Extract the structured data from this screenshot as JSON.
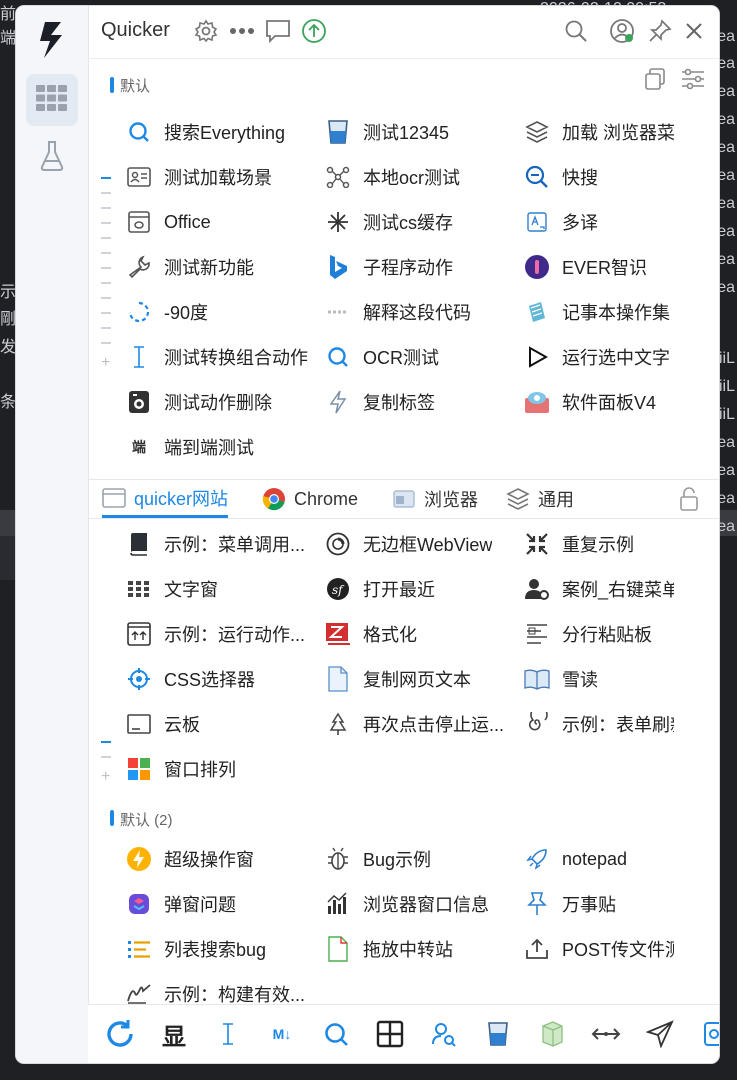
{
  "background": {
    "right_fragments": [
      "ea",
      "ea",
      "ea",
      "ea",
      "ea",
      "ea",
      "ea",
      "ea",
      "ea",
      "ea",
      "iiL",
      "iiL",
      "iiL",
      "ea",
      "ea",
      "ea",
      "ea"
    ],
    "left_fragments": [
      "示",
      "剛",
      "发",
      "条"
    ],
    "top_fragment": "前端",
    "top_clock": "2026-02-10 09:53"
  },
  "header": {
    "title": "Quicker",
    "icons": [
      "gear-icon",
      "more-icon",
      "chat-icon",
      "upgrade-icon",
      "search-icon",
      "user-icon",
      "pin-icon",
      "close-icon"
    ]
  },
  "group1": {
    "label": "默认",
    "items": [
      {
        "label": "搜索Everything",
        "icon": "search-everything-icon"
      },
      {
        "label": "测试12345",
        "icon": "cup-icon"
      },
      {
        "label": "加载 浏览器菜...",
        "icon": "layers-icon"
      },
      {
        "label": "测试加载场景",
        "icon": "id-card-icon"
      },
      {
        "label": "本地ocr测试",
        "icon": "nodes-icon"
      },
      {
        "label": "快搜",
        "icon": "quick-search-icon"
      },
      {
        "label": "Office",
        "icon": "office-icon"
      },
      {
        "label": "测试cs缓存",
        "icon": "asterisk-icon"
      },
      {
        "label": "多译",
        "icon": "translate-icon"
      },
      {
        "label": "测试新功能",
        "icon": "wrench-icon"
      },
      {
        "label": "子程序动作",
        "icon": "bing-icon"
      },
      {
        "label": "EVER智识",
        "icon": "ever-icon"
      },
      {
        "label": "-90度",
        "icon": "rotate-icon"
      },
      {
        "label": "解释这段代码",
        "icon": "code-icon"
      },
      {
        "label": "记事本操作集",
        "icon": "notepad-icon"
      },
      {
        "label": "测试转换组合动作",
        "icon": "text-cursor-icon"
      },
      {
        "label": "OCR测试",
        "icon": "ocr-search-icon"
      },
      {
        "label": "运行选中文字",
        "icon": "play-icon"
      },
      {
        "label": "测试动作删除",
        "icon": "camera-icon"
      },
      {
        "label": "复制标签",
        "icon": "bolt-icon"
      },
      {
        "label": "软件面板V4",
        "icon": "panel-icon"
      },
      {
        "label": "端到端测试",
        "icon": "duan-icon",
        "glyph": "端"
      }
    ]
  },
  "tabs": [
    {
      "label": "quicker网站",
      "icon": "browser-icon",
      "active": true
    },
    {
      "label": "Chrome",
      "icon": "chrome-icon",
      "active": false
    },
    {
      "label": "浏览器",
      "icon": "window-icon",
      "active": false
    },
    {
      "label": "通用",
      "icon": "layers-icon",
      "active": false
    }
  ],
  "group2": {
    "items": [
      {
        "label": "示例：菜单调用...",
        "icon": "book-icon"
      },
      {
        "label": "无边框WebView",
        "icon": "webview-icon"
      },
      {
        "label": "重复示例",
        "icon": "shrink-icon"
      },
      {
        "label": "文字窗",
        "icon": "grid-dots-icon"
      },
      {
        "label": "打开最近",
        "icon": "symfony-icon"
      },
      {
        "label": "案例_右键菜单...",
        "icon": "user-gear-icon"
      },
      {
        "label": "示例：运行动作...",
        "icon": "upload-box-icon"
      },
      {
        "label": "格式化",
        "icon": "zend-icon"
      },
      {
        "label": "分行粘贴板",
        "icon": "lines-icon"
      },
      {
        "label": "CSS选择器",
        "icon": "target-icon"
      },
      {
        "label": "复制网页文本",
        "icon": "document-icon"
      },
      {
        "label": "雪读",
        "icon": "open-book-icon"
      },
      {
        "label": "云板",
        "icon": "tray-icon"
      },
      {
        "label": "再次点击停止运...",
        "icon": "tree-icon"
      },
      {
        "label": "示例：表单刷新...",
        "icon": "spiral-icon"
      },
      {
        "label": "窗口排列",
        "icon": "tiles-icon"
      }
    ]
  },
  "group3": {
    "label": "默认 (2)",
    "items": [
      {
        "label": "超级操作窗",
        "icon": "lightning-circle-icon"
      },
      {
        "label": "Bug示例",
        "icon": "bug-icon"
      },
      {
        "label": "notepad",
        "icon": "rocket-icon"
      },
      {
        "label": "弹窗问题",
        "icon": "shortcuts-icon"
      },
      {
        "label": "浏览器窗口信息",
        "icon": "bar-chart-icon"
      },
      {
        "label": "万事贴",
        "icon": "pushpin-icon"
      },
      {
        "label": "列表搜索bug",
        "icon": "list-icon"
      },
      {
        "label": "拖放中转站",
        "icon": "file-icon"
      },
      {
        "label": "POST传文件测试",
        "icon": "upload-icon"
      },
      {
        "label": "示例：构建有效...",
        "icon": "signature-icon"
      }
    ]
  },
  "bottom": {
    "items": [
      {
        "icon": "refresh-icon"
      },
      {
        "icon": "xian-icon",
        "glyph": "显"
      },
      {
        "icon": "text-cursor-icon"
      },
      {
        "icon": "markdown-icon",
        "glyph": "M↓"
      },
      {
        "icon": "search-icon"
      },
      {
        "icon": "grid-window-icon"
      },
      {
        "icon": "user-search-icon"
      },
      {
        "icon": "cup-icon"
      },
      {
        "icon": "cube-icon"
      },
      {
        "icon": "resize-icon"
      },
      {
        "icon": "send-icon"
      },
      {
        "icon": "app-icon"
      }
    ]
  },
  "colors": {
    "accent": "#1e88e5",
    "window": "#ffffff",
    "sidebar": "#f4f6f9"
  }
}
